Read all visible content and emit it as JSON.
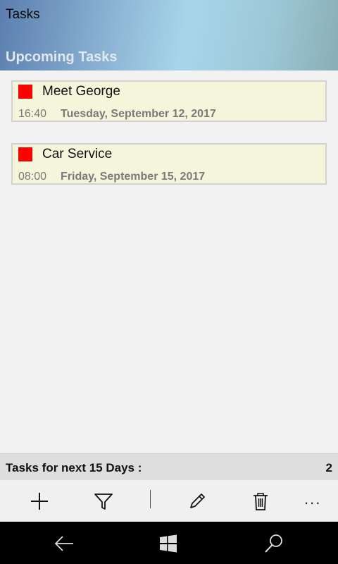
{
  "header": {
    "title": "Tasks",
    "section": "Upcoming Tasks"
  },
  "tasks": [
    {
      "title": "Meet George",
      "time": "16:40",
      "date": "Tuesday, September 12, 2017",
      "color": "#ff0000"
    },
    {
      "title": "Car Service",
      "time": "08:00",
      "date": "Friday, September 15, 2017",
      "color": "#ff0000"
    }
  ],
  "summary": {
    "label": "Tasks for next 15 Days :",
    "count": "2"
  },
  "app_bar": {
    "more": "...",
    "icons": [
      "add-icon",
      "filter-icon",
      "edit-icon",
      "delete-icon"
    ]
  },
  "nav_bar": {
    "icons": [
      "back-icon",
      "windows-start-icon",
      "search-icon"
    ]
  }
}
